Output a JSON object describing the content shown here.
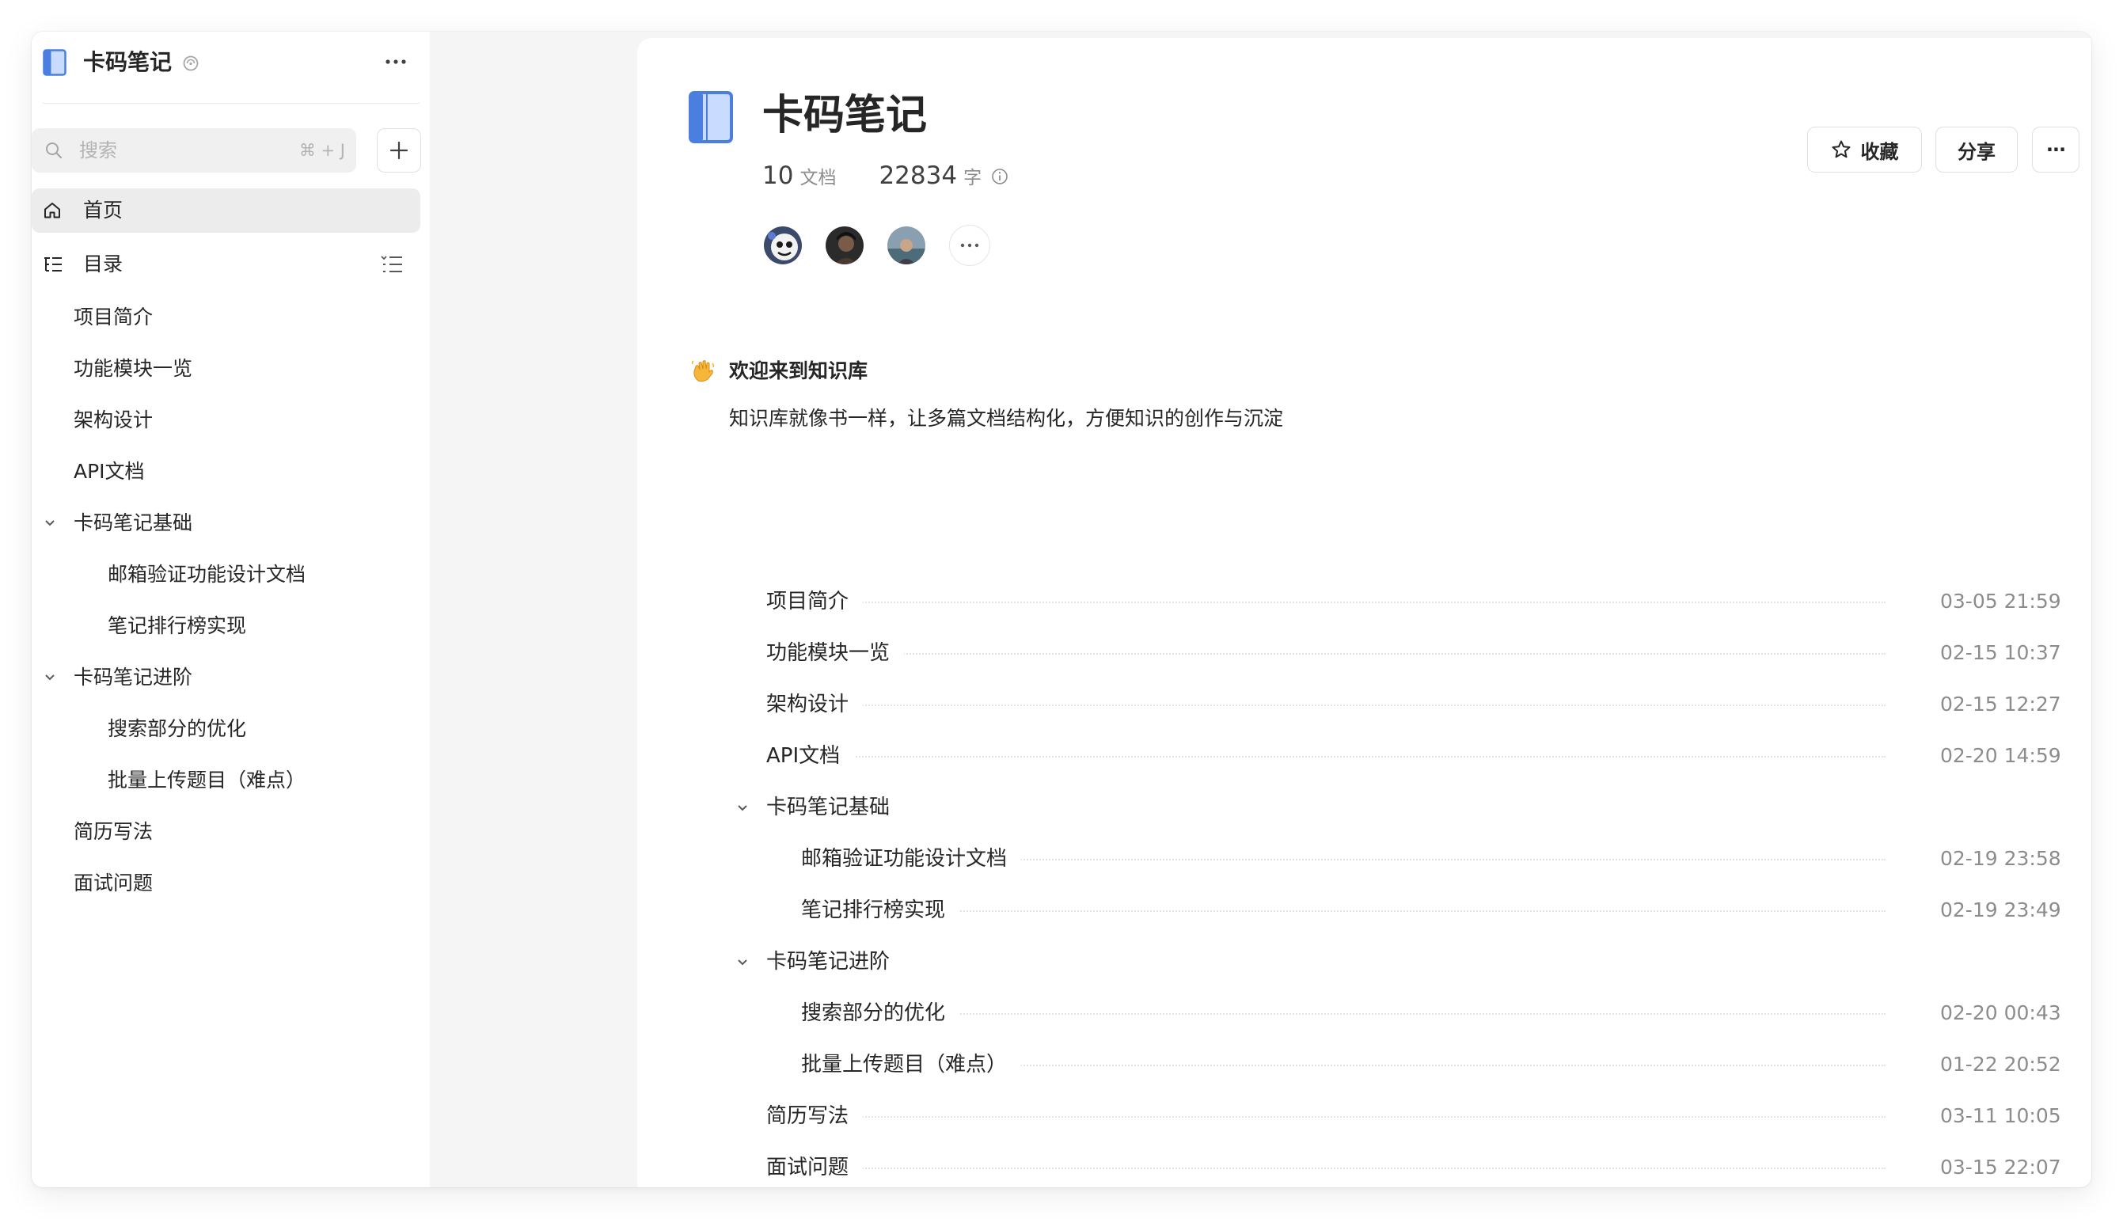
{
  "sidebar": {
    "title": "卡码笔记",
    "search": {
      "placeholder": "搜索",
      "shortcut": "⌘ + J"
    },
    "home_label": "首页",
    "toc_label": "目录",
    "items": [
      {
        "label": "项目简介",
        "level": 1
      },
      {
        "label": "功能模块一览",
        "level": 1
      },
      {
        "label": "架构设计",
        "level": 1
      },
      {
        "label": "API文档",
        "level": 1
      },
      {
        "label": "卡码笔记基础",
        "level": 1,
        "expanded": true
      },
      {
        "label": "邮箱验证功能设计文档",
        "level": 2
      },
      {
        "label": "笔记排行榜实现",
        "level": 2
      },
      {
        "label": "卡码笔记进阶",
        "level": 1,
        "expanded": true
      },
      {
        "label": "搜索部分的优化",
        "level": 2
      },
      {
        "label": "批量上传题目（难点）",
        "level": 2
      },
      {
        "label": "简历写法",
        "level": 1
      },
      {
        "label": "面试问题",
        "level": 1
      }
    ]
  },
  "header": {
    "title": "卡码笔记",
    "doc_count": "10",
    "doc_unit": "文档",
    "word_count": "22834",
    "word_unit": "字",
    "favorite_label": "收藏",
    "share_label": "分享",
    "more_label": "···"
  },
  "welcome": {
    "title": "欢迎来到知识库",
    "description": "知识库就像书一样，让多篇文档结构化，方便知识的创作与沉淀"
  },
  "documents": [
    {
      "title": "项目简介",
      "date": "03-05 21:59",
      "level": 1
    },
    {
      "title": "功能模块一览",
      "date": "02-15 10:37",
      "level": 1
    },
    {
      "title": "架构设计",
      "date": "02-15 12:27",
      "level": 1
    },
    {
      "title": "API文档",
      "date": "02-20 14:59",
      "level": 1
    },
    {
      "title": "卡码笔记基础",
      "date": "",
      "level": 1,
      "group": true
    },
    {
      "title": "邮箱验证功能设计文档",
      "date": "02-19 23:58",
      "level": 2
    },
    {
      "title": "笔记排行榜实现",
      "date": "02-19 23:49",
      "level": 2
    },
    {
      "title": "卡码笔记进阶",
      "date": "",
      "level": 1,
      "group": true
    },
    {
      "title": "搜索部分的优化",
      "date": "02-20 00:43",
      "level": 2
    },
    {
      "title": "批量上传题目（难点）",
      "date": "01-22 20:52",
      "level": 2
    },
    {
      "title": "简历写法",
      "date": "03-11 10:05",
      "level": 1
    },
    {
      "title": "面试问题",
      "date": "03-15 22:07",
      "level": 1
    }
  ],
  "colors": {
    "accent_blue": "#4a7fe0",
    "book_fill": "#c9dcff",
    "text_primary": "#262626",
    "text_secondary": "#8c8c8c"
  }
}
